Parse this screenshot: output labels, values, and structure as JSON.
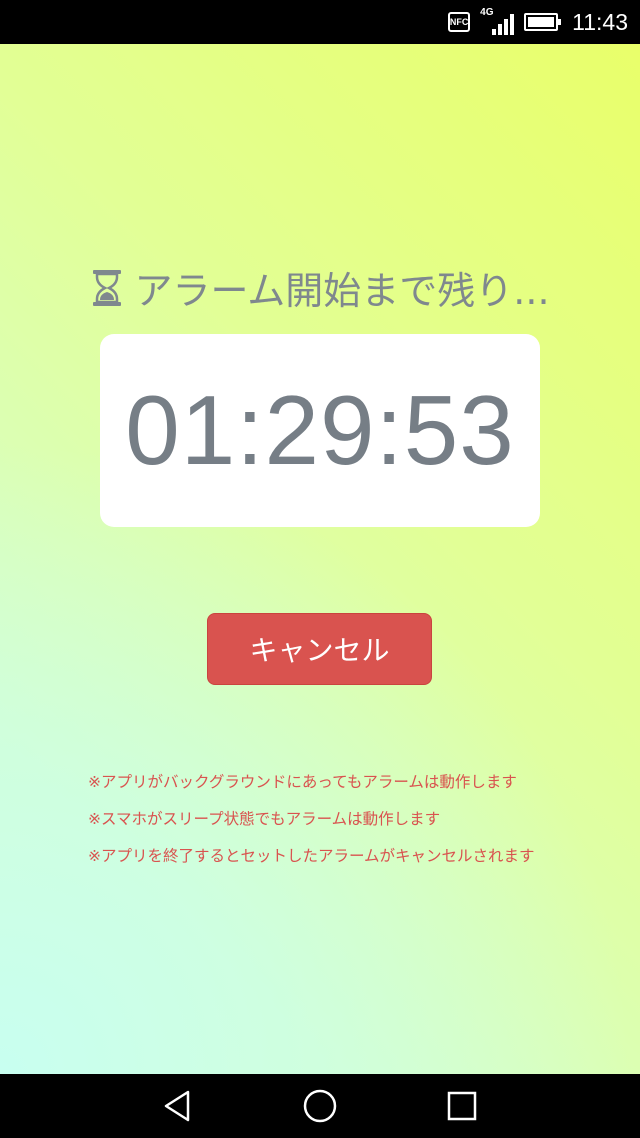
{
  "status_bar": {
    "nfc_label": "NFC",
    "network_label": "4G",
    "time": "11:43",
    "icons": [
      "nfc-icon",
      "signal-icon",
      "battery-icon"
    ]
  },
  "main": {
    "title": "アラーム開始まで残り...",
    "title_icon": "hourglass-icon",
    "countdown": "01:29:53",
    "cancel_label": "キャンセル",
    "notes": [
      "※アプリがバックグラウンドにあってもアラームは動作します",
      "※スマホがスリープ状態でもアラームは動作します",
      "※アプリを終了するとセットしたアラームがキャンセルされます"
    ]
  },
  "colors": {
    "accent": "#d9534f",
    "title_text": "#7f888e",
    "timer_text": "#767e86"
  },
  "nav_bar": {
    "icons": [
      "back-icon",
      "home-icon",
      "recents-icon"
    ]
  }
}
